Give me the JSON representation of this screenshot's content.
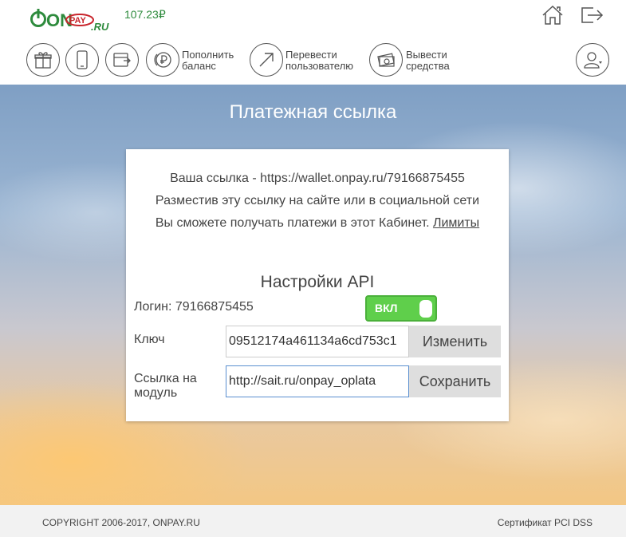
{
  "header": {
    "logo_text_on": "ON",
    "logo_text_pay": "PAY",
    "logo_text_ru": ".RU",
    "balance_value": "107.23",
    "balance_currency": "₽"
  },
  "nav": {
    "topup_label_1": "Пополнить",
    "topup_label_2": "баланс",
    "transfer_label_1": "Перевести",
    "transfer_label_2": "пользователю",
    "withdraw_label_1": "Вывести",
    "withdraw_label_2": "средства"
  },
  "page": {
    "title": "Платежная ссылка"
  },
  "card": {
    "link_line": "Ваша ссылка - https://wallet.onpay.ru/79166875455",
    "place_line": "Разместив эту ссылку на сайте или в социальной сети",
    "receive_line": "Вы сможете получать платежи в этот Кабинет.",
    "limits_link": "Лимиты",
    "api_title": "Настройки API",
    "login_label": "Логин: 79166875455",
    "toggle_label": "ВКЛ",
    "key_label": "Ключ",
    "key_value": "09512174a461134a6cd753c1",
    "change_button": "Изменить",
    "module_label_1": "Ссылка на",
    "module_label_2": "модуль",
    "module_value": "http://sait.ru/onpay_oplata",
    "save_button": "Сохранить"
  },
  "footer": {
    "copyright": "COPYRIGHT 2006-2017, ONPAY.RU",
    "certificate": "Сертификат PCI DSS"
  },
  "colors": {
    "brand_green": "#2e8b3d",
    "logo_red": "#c8242b",
    "toggle_green": "#5fcf4b"
  },
  "icons": [
    "gift-icon",
    "mobile-icon",
    "card-icon",
    "ruble-coin-icon",
    "arrow-up-right-icon",
    "cash-icon",
    "home-icon",
    "logout-icon",
    "user-icon"
  ]
}
